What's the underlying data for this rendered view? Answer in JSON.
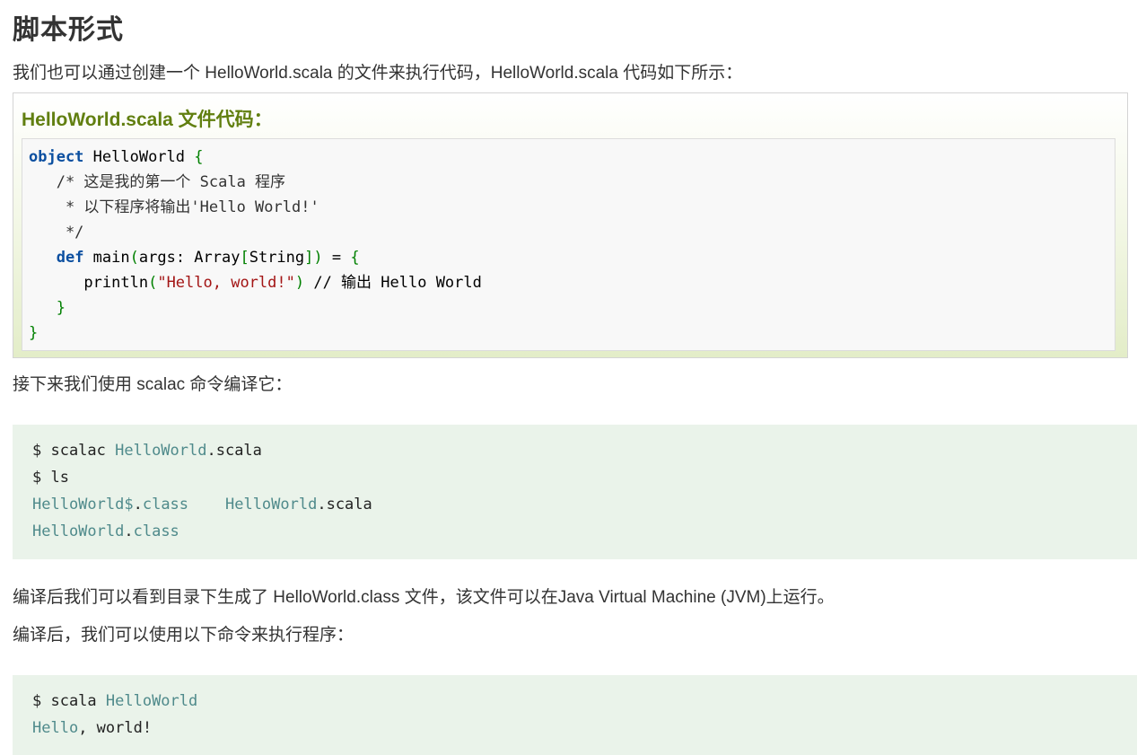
{
  "heading": "脚本形式",
  "intro": "我们也可以通过创建一个 HelloWorld.scala 的文件来执行代码，HelloWorld.scala 代码如下所示：",
  "example": {
    "title": "HelloWorld.scala 文件代码：",
    "code": {
      "l1_kw": "object",
      "l1_rest": " HelloWorld ",
      "l1_brace": "{",
      "l2": "   /* 这是我的第一个 Scala 程序",
      "l3": "    * 以下程序将输出'Hello World!'",
      "l4": "    */",
      "l5_indent": "   ",
      "l5_kw": "def",
      "l5_a": " main",
      "l5_p1": "(",
      "l5_b": "args: Array",
      "l5_s1": "[",
      "l5_c": "String",
      "l5_s2": "]",
      "l5_p2": ")",
      "l5_d": " = ",
      "l5_brace": "{",
      "l6_indent": "      ",
      "l6_fn": "println",
      "l6_p1": "(",
      "l6_str": "\"Hello, world!\"",
      "l6_p2": ")",
      "l6_cm": " // 输出 Hello World",
      "l7_indent": "   ",
      "l7_brace": "}",
      "l8_brace": "}"
    }
  },
  "compile_text": "接下来我们使用 scalac 命令编译它：",
  "shell1": {
    "l1_a": "$ scalac ",
    "l1_b": "HelloWorld",
    "l1_c": ".scala",
    "l2": "$ ls",
    "l3_a": "HelloWorld$",
    "l3_b": ".",
    "l3_c": "class",
    "l3_d": "    ",
    "l3_e": "HelloWorld",
    "l3_f": ".scala",
    "l4_a": "HelloWorld",
    "l4_b": ".",
    "l4_c": "class"
  },
  "after_compile": "编译后我们可以看到目录下生成了 HelloWorld.class 文件，该文件可以在Java Virtual Machine (JVM)上运行。",
  "run_text": "编译后，我们可以使用以下命令来执行程序：",
  "shell2": {
    "l1_a": "$ scala ",
    "l1_b": "HelloWorld",
    "l2_a": "Hello",
    "l2_b": ", world!"
  }
}
